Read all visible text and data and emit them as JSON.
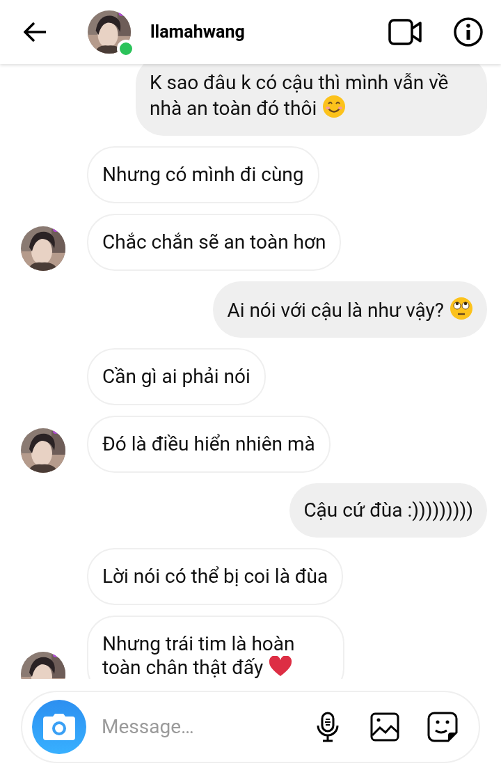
{
  "header": {
    "username": "llamahwang",
    "online": true
  },
  "messages": [
    {
      "kind": "sent",
      "avatar": false,
      "content": [
        {
          "kind": "text",
          "text": "K sao đâu k có cậu thì mình vẫn về nhà an toàn đó thôi"
        },
        {
          "kind": "smile"
        }
      ]
    },
    {
      "kind": "received",
      "avatar": false,
      "content": [
        {
          "kind": "text",
          "text": "Nhưng có mình đi cùng"
        }
      ]
    },
    {
      "kind": "received",
      "avatar": true,
      "content": [
        {
          "kind": "text",
          "text": "Chắc chắn sẽ an toàn hơn"
        }
      ]
    },
    {
      "kind": "sent",
      "avatar": false,
      "content": [
        {
          "kind": "text",
          "text": "Ai nói với cậu là như vậy?"
        },
        {
          "kind": "eye-roll"
        }
      ]
    },
    {
      "kind": "received",
      "avatar": false,
      "content": [
        {
          "kind": "text",
          "text": "Cần gì ai phải nói"
        }
      ]
    },
    {
      "kind": "received",
      "avatar": true,
      "content": [
        {
          "kind": "text",
          "text": "Đó là điều hiển nhiên mà"
        }
      ]
    },
    {
      "kind": "sent",
      "avatar": false,
      "content": [
        {
          "kind": "text",
          "text": "Cậu cứ đùa :)))))))))"
        }
      ]
    },
    {
      "kind": "received",
      "avatar": false,
      "content": [
        {
          "kind": "text",
          "text": "Lời nói có thể bị coi là đùa"
        }
      ]
    },
    {
      "kind": "received",
      "avatar": true,
      "content": [
        {
          "kind": "text",
          "text": "Nhưng trái tim là hoàn toàn chân thật đấy"
        },
        {
          "kind": "heart"
        }
      ]
    }
  ],
  "composer": {
    "placeholder": "Message…"
  }
}
